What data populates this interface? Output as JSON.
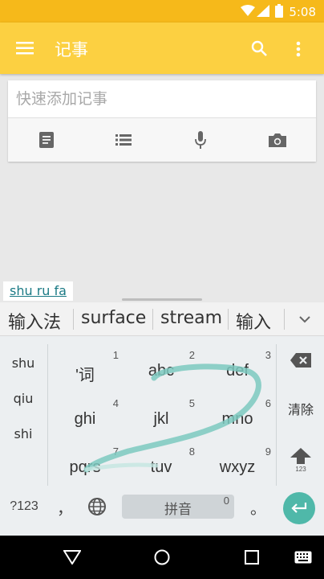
{
  "status_bar": {
    "time": "5:08",
    "icons": [
      "wifi-icon",
      "signal-icon",
      "battery-icon"
    ]
  },
  "app_bar": {
    "title": "记事",
    "icons": [
      "menu-icon",
      "search-icon",
      "more-vert-icon"
    ],
    "color": "#fcd041"
  },
  "note_card": {
    "placeholder": "快速添加记事",
    "value": "",
    "tools": [
      "text-note-icon",
      "list-icon",
      "mic-icon",
      "camera-icon"
    ]
  },
  "composing": {
    "text": "shu ru fa"
  },
  "keyboard": {
    "candidates": [
      "输入法",
      "surface",
      "stream",
      "输入"
    ],
    "side_candidates": [
      "shu",
      "qiu",
      "shi"
    ],
    "keys": [
      {
        "label": "'词",
        "number": "1"
      },
      {
        "label": "abc",
        "number": "2"
      },
      {
        "label": "def",
        "number": "3"
      },
      {
        "label": "ghi",
        "number": "4"
      },
      {
        "label": "jkl",
        "number": "5"
      },
      {
        "label": "mno",
        "number": "6"
      },
      {
        "label": "pqrs",
        "number": "7"
      },
      {
        "label": "tuv",
        "number": "8"
      },
      {
        "label": "wxyz",
        "number": "9"
      }
    ],
    "clear_label": "清除",
    "shift_sub": "123",
    "symbols_label": "?123",
    "comma_label": "，",
    "space_label": "拼音",
    "space_number": "0",
    "period_label": "。",
    "accent_color": "#4fb8a9"
  },
  "nav_bar": {
    "buttons": [
      "back-icon",
      "home-icon",
      "recents-icon",
      "keyboard-icon"
    ]
  }
}
